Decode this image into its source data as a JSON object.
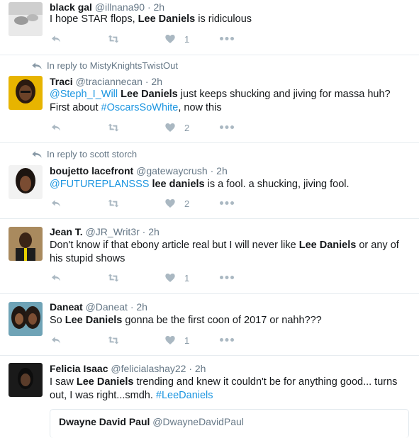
{
  "tweets": [
    {
      "reply_to": "",
      "name": "black gal",
      "handle": "@illnana90",
      "time": "· 2h",
      "parts": [
        "I hope STAR flops,  ",
        "Lee Daniels",
        " is ridiculous"
      ],
      "likes": "1"
    },
    {
      "reply_to": "In reply to MistyKnightsTwistOut",
      "name": "Traci",
      "handle": "@traciannecan",
      "time": "· 2h",
      "parts": [
        "@Steph_I_Will",
        " ",
        "Lee Daniels",
        " just keeps shucking and jiving for massa huh? First about ",
        "#OscarsSoWhite",
        ", now this"
      ],
      "likes": "2"
    },
    {
      "reply_to": "In reply to scott storch",
      "name": "boujetto lacefront",
      "handle": "@gatewaycrush",
      "time": "· 2h",
      "parts": [
        "@FUTUREPLANSSS",
        " ",
        "lee daniels",
        " is a fool. a shucking, jiving fool."
      ],
      "likes": "2"
    },
    {
      "reply_to": "",
      "name": "Jean T.",
      "handle": "@JR_Writ3r",
      "time": "· 2h",
      "parts": [
        "Don't know if that ebony article real but I will never like ",
        "Lee Daniels",
        " or any of his stupid shows"
      ],
      "likes": "1"
    },
    {
      "reply_to": "",
      "name": "Daneat",
      "handle": "@Daneat",
      "time": "· 2h",
      "parts": [
        "So ",
        "Lee Daniels",
        " gonna be the first coon of 2017 or nahh???"
      ],
      "likes": "1"
    },
    {
      "reply_to": "",
      "name": "Felicia Isaac",
      "handle": "@felicialashay22",
      "time": "· 2h",
      "parts": [
        "I saw ",
        "Lee Daniels",
        " trending and knew it couldn't be for anything good... turns out, I was right...smdh. ",
        "#LeeDaniels"
      ],
      "likes": "",
      "quote": {
        "name": "Dwayne David Paul",
        "handle": "@DwayneDavidPaul"
      }
    }
  ],
  "icons": {
    "reply": "reply-icon",
    "retweet": "retweet-icon",
    "like": "heart-icon",
    "more": "more-icon",
    "reply_context": "reply-arrow-icon"
  },
  "colors": {
    "link": "#1b95e0",
    "muted": "#657786",
    "icon": "#aab8c2",
    "border": "#e6ecf0"
  }
}
